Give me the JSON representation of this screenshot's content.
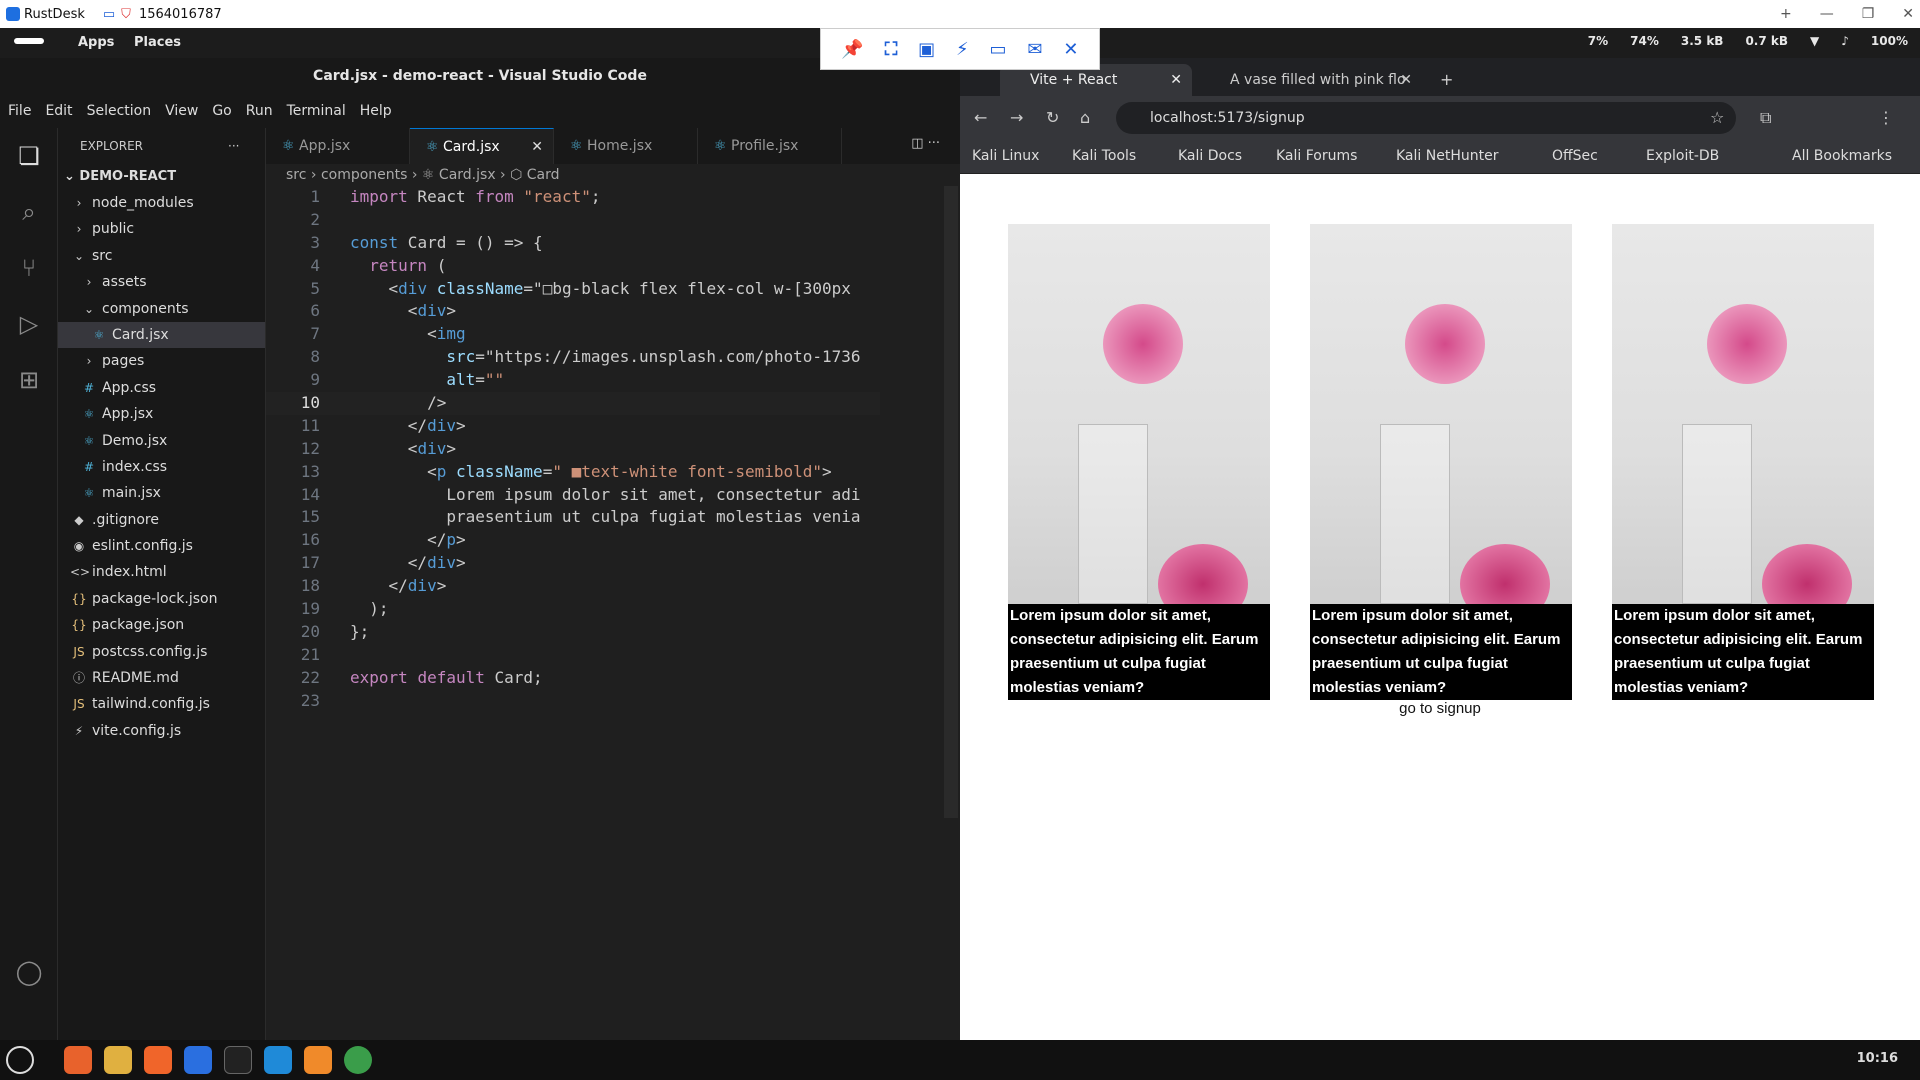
{
  "rustdesk": {
    "app": "RustDesk",
    "id": "1564016787"
  },
  "panel": {
    "apps": "Apps",
    "places": "Places",
    "cpu": "7%",
    "mem": "74%",
    "up": "3.5 kB",
    "down": "0.7 kB",
    "vol": "100%"
  },
  "vscode": {
    "title": "Card.jsx - demo-react - Visual Studio Code",
    "menu": [
      "File",
      "Edit",
      "Selection",
      "View",
      "Go",
      "Run",
      "Terminal",
      "Help"
    ],
    "explorer": "EXPLORER",
    "root": "DEMO-REACT",
    "tree": [
      {
        "n": "node_modules",
        "ic": "›",
        "d": 1
      },
      {
        "n": "public",
        "ic": "›",
        "d": 1
      },
      {
        "n": "src",
        "ic": "⌄",
        "d": 1
      },
      {
        "n": "assets",
        "ic": "›",
        "d": 2
      },
      {
        "n": "components",
        "ic": "⌄",
        "d": 2
      },
      {
        "n": "Card.jsx",
        "ic": "⚛",
        "d": 3,
        "sel": true
      },
      {
        "n": "pages",
        "ic": "›",
        "d": 2
      },
      {
        "n": "App.css",
        "ic": "#",
        "d": 2
      },
      {
        "n": "App.jsx",
        "ic": "⚛",
        "d": 2
      },
      {
        "n": "Demo.jsx",
        "ic": "⚛",
        "d": 2
      },
      {
        "n": "index.css",
        "ic": "#",
        "d": 2
      },
      {
        "n": "main.jsx",
        "ic": "⚛",
        "d": 2
      },
      {
        "n": ".gitignore",
        "ic": "◆",
        "d": 1
      },
      {
        "n": "eslint.config.js",
        "ic": "◉",
        "d": 1
      },
      {
        "n": "index.html",
        "ic": "<>",
        "d": 1
      },
      {
        "n": "package-lock.json",
        "ic": "{}",
        "d": 1
      },
      {
        "n": "package.json",
        "ic": "{}",
        "d": 1
      },
      {
        "n": "postcss.config.js",
        "ic": "JS",
        "d": 1
      },
      {
        "n": "README.md",
        "ic": "ⓘ",
        "d": 1
      },
      {
        "n": "tailwind.config.js",
        "ic": "JS",
        "d": 1
      },
      {
        "n": "vite.config.js",
        "ic": "⚡",
        "d": 1
      }
    ],
    "tabs": [
      "App.jsx",
      "Card.jsx",
      "Home.jsx",
      "Profile.jsx"
    ],
    "breadcrumb": "src  ›  components  ›  ⚛ Card.jsx  ›  ⬡ Card",
    "code": [
      "import React from \"react\";",
      "",
      "const Card = () => {",
      "  return (",
      "    <div className=\"□bg-black flex flex-col w-[300px",
      "      <div>",
      "        <img",
      "          src=\"https://images.unsplash.com/photo-1736",
      "          alt=\"\"",
      "        />",
      "      </div>",
      "      <div>",
      "        <p className=\" ■text-white font-semibold\">",
      "          Lorem ipsum dolor sit amet, consectetur adi",
      "          praesentium ut culpa fugiat molestias venia",
      "        </p>",
      "      </div>",
      "    </div>",
      "  );",
      "};",
      "",
      "export default Card;",
      ""
    ]
  },
  "browser": {
    "tab1": "Vite + React",
    "tab2": "A vase filled with pink flo",
    "url": "localhost:5173/signup",
    "bookmarks": [
      "Kali Linux",
      "Kali Tools",
      "Kali Docs",
      "Kali Forums",
      "Kali NetHunter",
      "OffSec",
      "Exploit-DB"
    ],
    "all_bookmarks": "All Bookmarks",
    "card_text": "Lorem ipsum dolor sit amet, consectetur adipisicing elit. Earum praesentium ut culpa fugiat molestias veniam?",
    "link": "go to signup"
  },
  "taskbar": {
    "clock": "10:16"
  }
}
